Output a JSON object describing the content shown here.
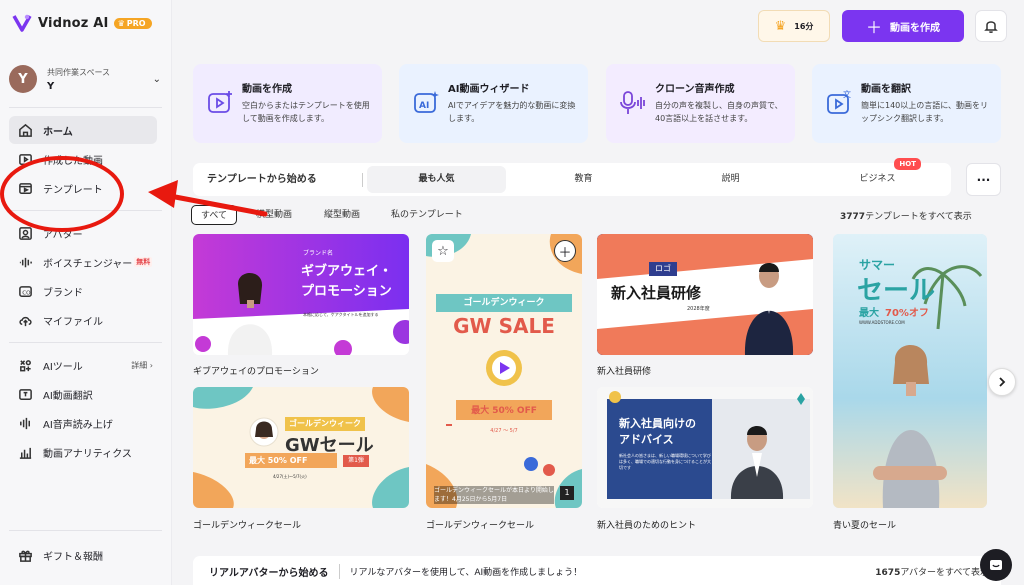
{
  "brand": {
    "name": "Vidnoz AI",
    "pro": "PRO"
  },
  "workspace": {
    "initial": "Y",
    "label": "共同作業スペース",
    "user": "Y"
  },
  "sidebar": {
    "items": [
      {
        "label": "ホーム"
      },
      {
        "label": "作成した動画"
      },
      {
        "label": "テンプレート"
      },
      {
        "label": "アバター"
      },
      {
        "label": "ボイスチェンジャー",
        "badge": "無料"
      },
      {
        "label": "ブランド"
      },
      {
        "label": "マイファイル"
      },
      {
        "label": "AIツール",
        "more": "詳細 ›"
      },
      {
        "label": "AI動画翻訳"
      },
      {
        "label": "AI音声読み上げ"
      },
      {
        "label": "動画アナリティクス"
      },
      {
        "label": "ギフト＆報酬"
      }
    ]
  },
  "header": {
    "credits": "16分",
    "create_label": "動画を作成"
  },
  "quick": [
    {
      "title": "動画を作成",
      "desc": "空白からまたはテンプレートを使用して動画を作成します。"
    },
    {
      "title": "AI動画ウィザード",
      "desc": "AIでアイデアを魅力的な動画に変換します。"
    },
    {
      "title": "クローン音声作成",
      "desc": "自分の声を複製し、自身の声質で、40言語以上を話させます。"
    },
    {
      "title": "動画を翻訳",
      "desc": "簡単に140以上の言語に、動画をリップシンク翻訳します。"
    }
  ],
  "templates": {
    "heading": "テンプレートから始める",
    "tabs": [
      "最も人気",
      "教育",
      "説明",
      "ビジネス"
    ],
    "hot": "HOT",
    "filters": [
      "すべて",
      "横型動画",
      "縦型動画",
      "私のテンプレート"
    ],
    "count_num": "3777",
    "count_text": "テンプレートをすべて表示",
    "cards": [
      {
        "caption": "ギブアウェイのプロモーション",
        "tag": "ブランド名",
        "title1": "ギブアウェイ・",
        "title2": "プロモーション",
        "sub": "本格に応じて、ケアクタイトルを追加する"
      },
      {
        "caption": "ゴールデンウィークセール",
        "tag": "ゴールデンウィーク",
        "title": "GW SALE",
        "price": "最大 50% OFF",
        "dates": "4/27 ～ 5/7",
        "bottom_text": "ゴールデンウィークセールが本日より開始します！4月25日から5月7日",
        "page": "1"
      },
      {
        "caption": "新入社員研修",
        "tag": "ロゴ",
        "title": "新入社員研修",
        "year": "2028年度"
      },
      {
        "caption": "青い夏のセール",
        "t1": "サマー",
        "t2": "セール",
        "t3": "最大",
        "t4": "70%オフ",
        "url": "WWW.ADDSTORE.COM"
      },
      {
        "caption": "ゴールデンウィークセール",
        "tag": "ゴールデンウィーク",
        "title": "GWセール",
        "price": "最大 50% OFF",
        "badge": "第1弾",
        "dates": "4/27(土)～5/7(火)"
      },
      {
        "caption": "新入社員のためのヒント",
        "title1": "新入社員向けの",
        "title2": "アドバイス",
        "body": "新社会人の皆さまは、新しい職場環境について学びは多く、職場での適切な行動を身につけることが大切です"
      }
    ]
  },
  "avatars": {
    "heading": "リアルアバターから始める",
    "desc": "リアルなアバターを使用して、AI動画を作成しましょう！",
    "count_num": "1675",
    "count_text": "アバターをすべて表示"
  }
}
